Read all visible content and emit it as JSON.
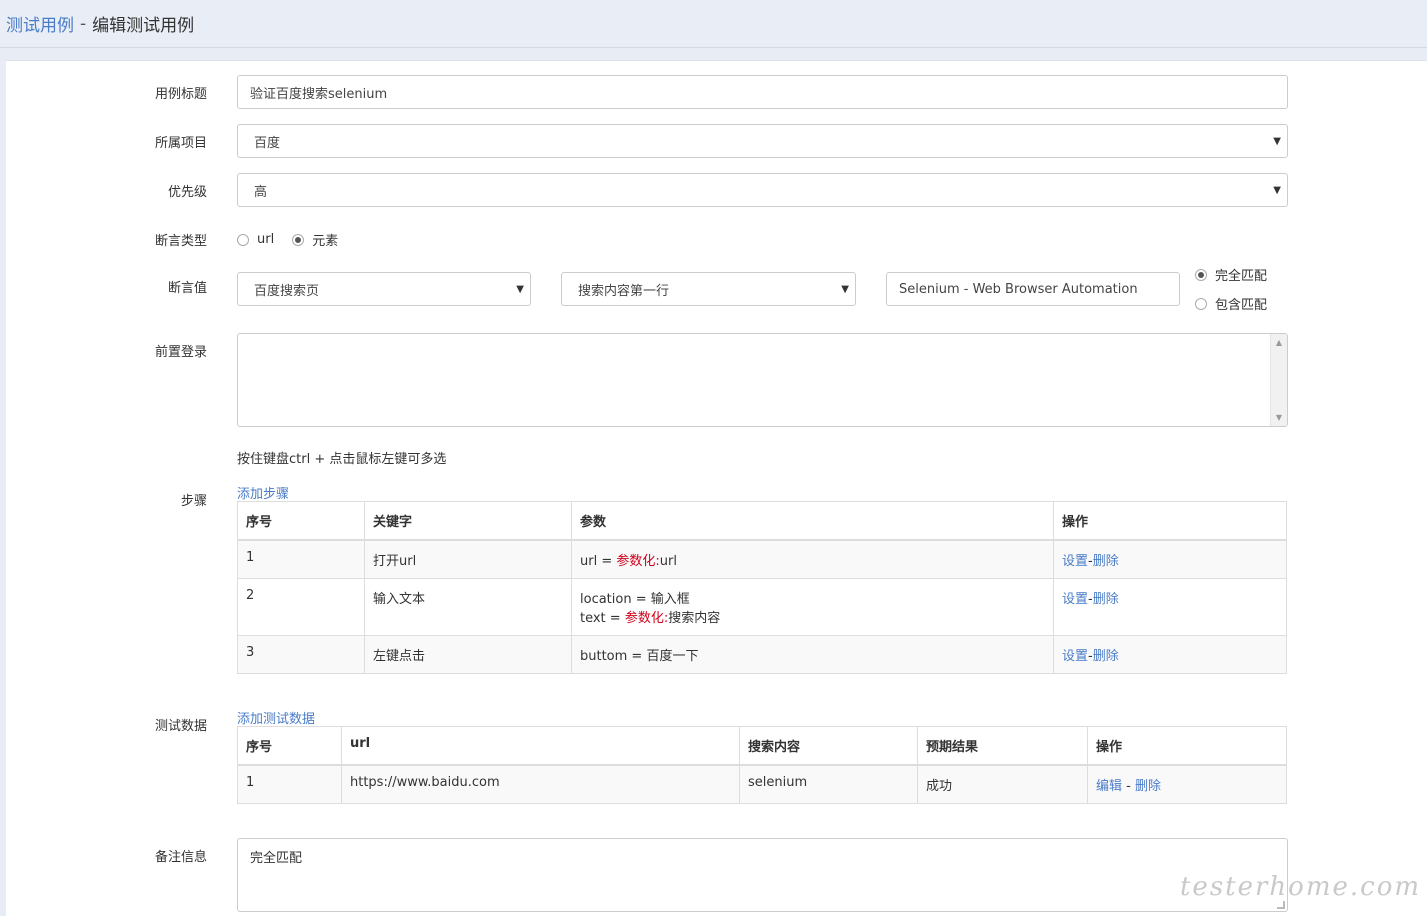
{
  "breadcrumb": {
    "parent": "测试用例",
    "separator": "-",
    "current": "编辑测试用例"
  },
  "form": {
    "title_label": "用例标题",
    "title_value": "验证百度搜索selenium",
    "project_label": "所属项目",
    "project_value": "百度",
    "priority_label": "优先级",
    "priority_value": "高",
    "assert_type_label": "断言类型",
    "assert_type_options": [
      "url",
      "元素"
    ],
    "assert_type_selected": "元素",
    "assert_value_label": "断言值",
    "assert_page_value": "百度搜索页",
    "assert_element_value": "搜索内容第一行",
    "assert_text_value": "Selenium - Web Browser Automation",
    "match_options": [
      "完全匹配",
      "包含匹配"
    ],
    "match_selected": "完全匹配",
    "pre_login_label": "前置登录",
    "multiselect_hint": "按住键盘ctrl + 点击鼠标左键可多选",
    "notes_label": "备注信息",
    "notes_value": "完全匹配"
  },
  "steps": {
    "label": "步骤",
    "add_link": "添加步骤",
    "headers": [
      "序号",
      "关键字",
      "参数",
      "操作"
    ],
    "rows": [
      {
        "no": "1",
        "keyword": "打开url",
        "param_lines": [
          {
            "prefix": "url = ",
            "red": "参数化:",
            "suffix": "url"
          }
        ]
      },
      {
        "no": "2",
        "keyword": "输入文本",
        "param_lines": [
          {
            "prefix": "location = 输入框",
            "red": "",
            "suffix": ""
          },
          {
            "prefix": "text = ",
            "red": "参数化:",
            "suffix": "搜索内容"
          }
        ]
      },
      {
        "no": "3",
        "keyword": "左键点击",
        "param_lines": [
          {
            "prefix": "buttom = 百度一下",
            "red": "",
            "suffix": ""
          }
        ]
      }
    ],
    "action_set": "设置",
    "action_sep": "-",
    "action_delete": "删除"
  },
  "test_data": {
    "label": "测试数据",
    "add_link": "添加测试数据",
    "headers": [
      "序号",
      "url",
      "搜索内容",
      "预期结果",
      "操作"
    ],
    "rows": [
      {
        "no": "1",
        "url": "https://www.baidu.com",
        "search": "selenium",
        "expected": "成功"
      }
    ],
    "action_edit": "编辑",
    "action_sep": " - ",
    "action_delete": "删除"
  },
  "watermark": "testerhome.com"
}
